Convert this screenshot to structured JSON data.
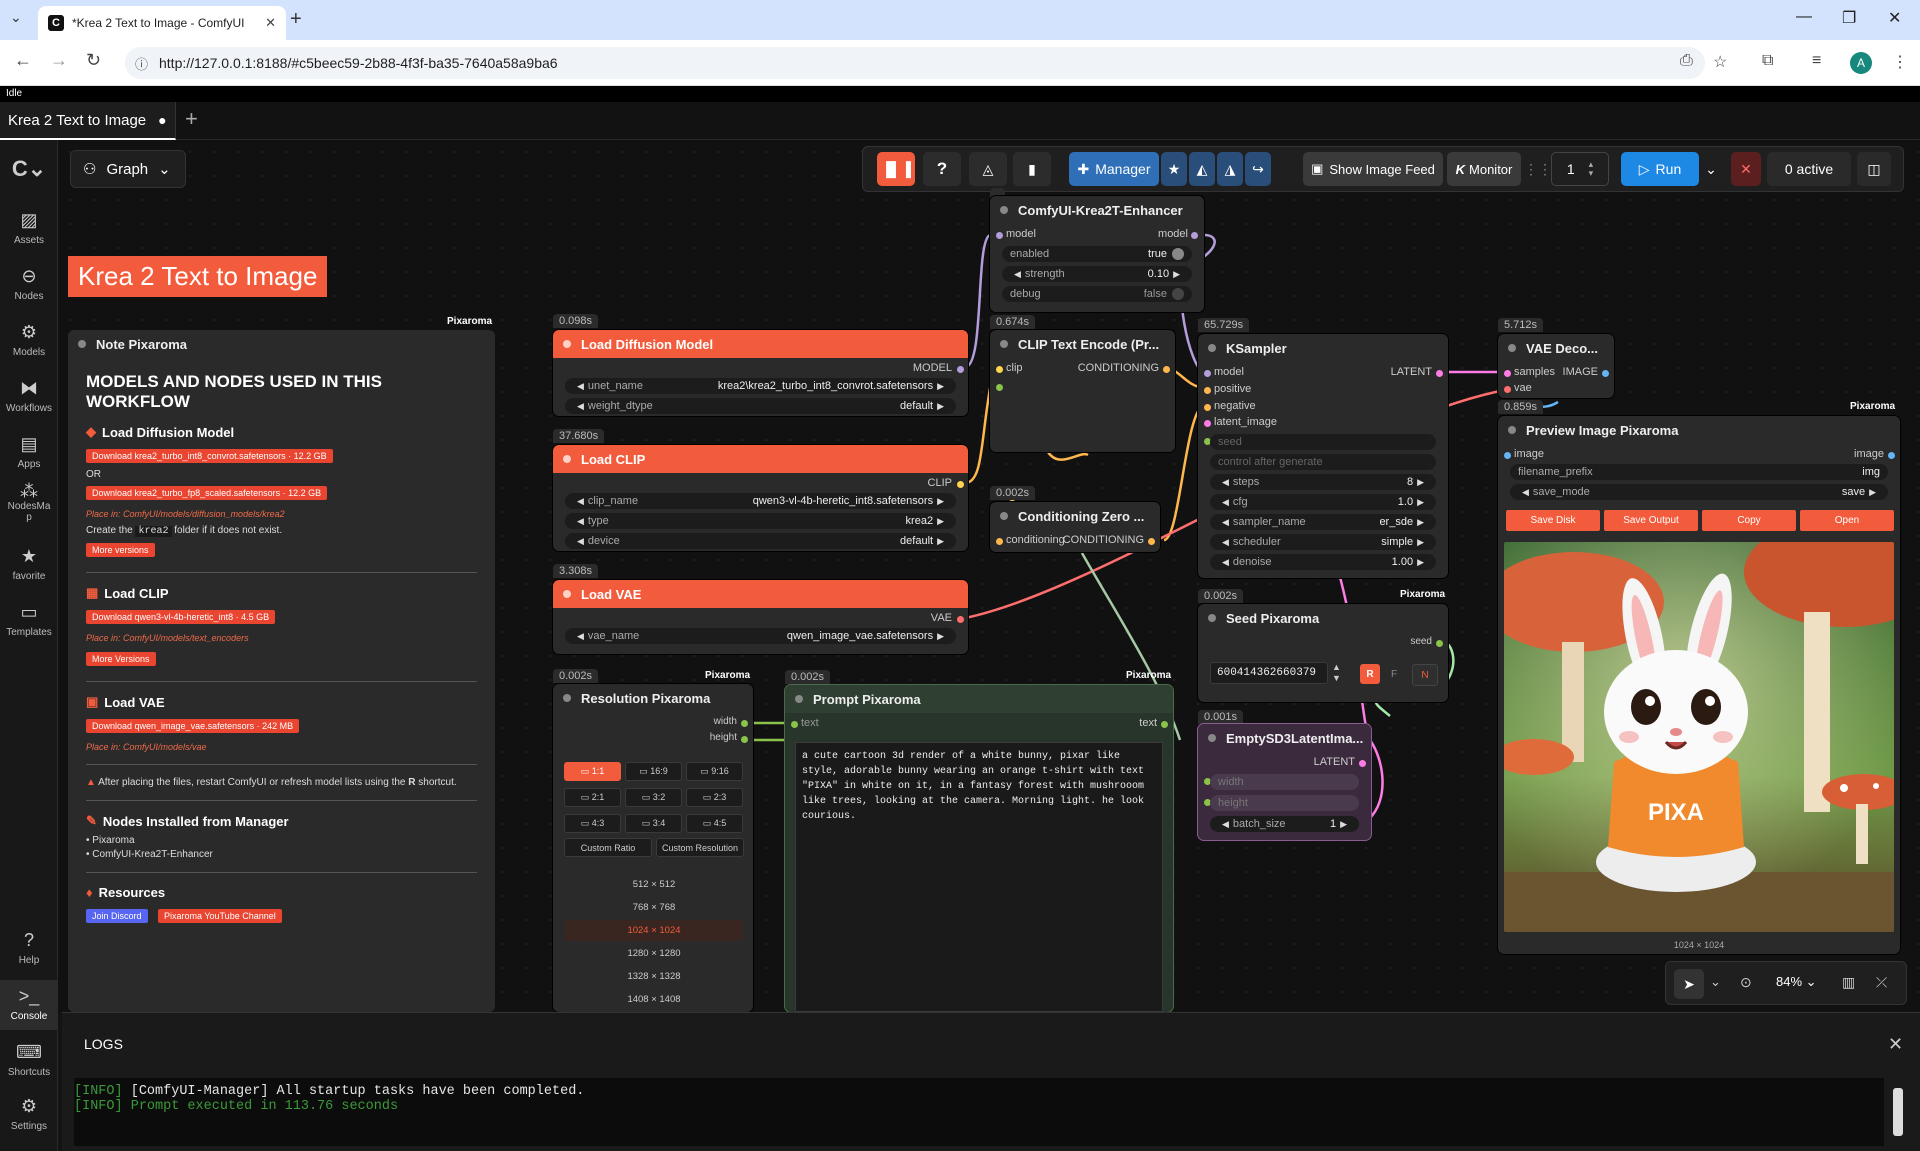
{
  "browser": {
    "tab_title": "*Krea 2 Text to Image - ComfyUI",
    "url": "http://127.0.0.1:8188/#c5beec59-2b88-4f3f-ba35-7640a58a9ba6",
    "avatar_letter": "A"
  },
  "app": {
    "status": "Idle",
    "workflow_tab": "Krea 2 Text to Image",
    "graph_label": "Graph",
    "canvas_title": "Krea 2 Text to Image"
  },
  "sidebar": {
    "items": [
      "Assets",
      "Nodes",
      "Models",
      "Workflows",
      "Apps",
      "NodesMap",
      "favorite",
      "Templates"
    ],
    "bottom": [
      "Help",
      "Console",
      "Shortcuts",
      "Settings"
    ]
  },
  "toolbar": {
    "manager": "Manager",
    "show_image_feed": "Show Image Feed",
    "monitor": "Monitor",
    "batch_count": "1",
    "run": "Run",
    "active": "0 active"
  },
  "note": {
    "tag": "Pixaroma",
    "title": "Note Pixaroma",
    "heading": "MODELS AND NODES USED IN THIS WORKFLOW",
    "s1_title": "Load Diffusion Model",
    "s1_dl1": "Download krea2_turbo_int8_convrot.safetensors · 12.2 GB",
    "s1_or": "OR",
    "s1_dl2": "Download krea2_turbo_fp8_scaled.safetensors · 12.2 GB",
    "s1_place": "Place in: ComfyUI/models/diffusion_models/krea2",
    "s1_create_a": "Create the",
    "s1_create_code": "krea2",
    "s1_create_b": "folder if it does not exist.",
    "s1_more": "More versions",
    "s2_title": "Load CLIP",
    "s2_dl": "Download qwen3-vl-4b-heretic_int8 · 4.5 GB",
    "s2_place": "Place in: ComfyUI/models/text_encoders",
    "s2_more": "More Versions",
    "s3_title": "Load VAE",
    "s3_dl": "Download qwen_image_vae.safetensors · 242 MB",
    "s3_place": "Place in: ComfyUI/models/vae",
    "warn_a": "After placing the files, restart ComfyUI or refresh model lists using the",
    "warn_key": "R",
    "warn_b": "shortcut.",
    "s4_title": "Nodes Installed from Manager",
    "s4_items": [
      "Pixaroma",
      "ComfyUI-Krea2T-Enhancer"
    ],
    "s5_title": "Resources",
    "discord": "Join Discord",
    "youtube": "Pixaroma YouTube Channel"
  },
  "nodes": {
    "enhancer": {
      "title": "ComfyUI-Krea2T-Enhancer",
      "in": "model",
      "out": "model",
      "w": [
        [
          "enabled",
          "true"
        ],
        [
          "strength",
          "0.10"
        ],
        [
          "debug",
          "false"
        ]
      ]
    },
    "load_diffusion": {
      "time": "0.098s",
      "title": "Load Diffusion Model",
      "out": "MODEL",
      "w": [
        [
          "unet_name",
          "krea2\\krea2_turbo_int8_convrot.safetensors"
        ],
        [
          "weight_dtype",
          "default"
        ]
      ]
    },
    "load_clip": {
      "time": "37.680s",
      "title": "Load CLIP",
      "out": "CLIP",
      "w": [
        [
          "clip_name",
          "qwen3-vl-4b-heretic_int8.safetensors"
        ],
        [
          "type",
          "krea2"
        ],
        [
          "device",
          "default"
        ]
      ]
    },
    "load_vae": {
      "time": "3.308s",
      "title": "Load VAE",
      "out": "VAE",
      "w": [
        [
          "vae_name",
          "qwen_image_vae.safetensors"
        ]
      ]
    },
    "clip_text": {
      "time": "0.674s",
      "title": "CLIP Text Encode (Pr...",
      "in": "clip",
      "out": "CONDITIONING"
    },
    "cond_zero": {
      "time": "0.002s",
      "title": "Conditioning Zero ...",
      "in": "conditioning",
      "out": "CONDITIONING"
    },
    "ksampler": {
      "time": "65.729s",
      "title": "KSampler",
      "out": "LATENT",
      "in": [
        "model",
        "positive",
        "negative",
        "latent_image",
        "seed"
      ],
      "control": "control after generate",
      "w": [
        [
          "steps",
          "8"
        ],
        [
          "cfg",
          "1.0"
        ],
        [
          "sampler_name",
          "er_sde"
        ],
        [
          "scheduler",
          "simple"
        ],
        [
          "denoise",
          "1.00"
        ]
      ]
    },
    "vae_decode": {
      "time": "5.712s",
      "title": "VAE Deco...",
      "in": [
        "samples",
        "vae"
      ],
      "out": "IMAGE"
    },
    "preview": {
      "time": "0.859s",
      "tag": "Pixaroma",
      "title": "Preview Image Pixaroma",
      "in": "image",
      "out": "image",
      "w": [
        [
          "filename_prefix",
          "img"
        ],
        [
          "save_mode",
          "save"
        ]
      ],
      "buttons": [
        "Save Disk",
        "Save Output",
        "Copy",
        "Open"
      ],
      "caption": "1024 × 1024",
      "shirt_text": "PIXA"
    },
    "seed": {
      "time": "0.002s",
      "tag": "Pixaroma",
      "title": "Seed Pixaroma",
      "out": "seed",
      "value": "600414362660379",
      "b1": "R",
      "b2": "F",
      "b3": "N"
    },
    "empty_latent": {
      "time": "0.001s",
      "title": "EmptySD3LatentIma...",
      "out": "LATENT",
      "w": [
        [
          "width",
          ""
        ],
        [
          "height",
          ""
        ],
        [
          "batch_size",
          "1"
        ]
      ]
    },
    "resolution": {
      "time": "0.002s",
      "tag": "Pixaroma",
      "title": "Resolution Pixaroma",
      "outs": [
        "width",
        "height"
      ],
      "ratios": [
        "1:1",
        "16:9",
        "9:16",
        "2:1",
        "3:2",
        "2:3",
        "4:3",
        "3:4",
        "4:5"
      ],
      "custom": [
        "Custom Ratio",
        "Custom Resolution"
      ],
      "sizes": [
        "512 × 512",
        "768 × 768",
        "1024 × 1024",
        "1280 × 1280",
        "1328 × 1328",
        "1408 × 1408"
      ]
    },
    "prompt": {
      "time": "0.002s",
      "tag": "Pixaroma",
      "title": "Prompt Pixaroma",
      "in": "text",
      "out": "text",
      "text": "a cute cartoon 3d render of a white bunny, pixar like style, adorable bunny wearing an orange t-shirt with text \"PIXA\" in white on it, in a fantasy forest with mushrooom like trees, looking at the camera. Morning light. he look courious."
    }
  },
  "canvas_controls": {
    "zoom": "84%"
  },
  "console": {
    "title": "LOGS",
    "lines": [
      {
        "tag": "[INFO]",
        "text": "[ComfyUI-Manager] All startup tasks have been completed."
      },
      {
        "tag": "[INFO]",
        "text": "Prompt executed in 113.76 seconds"
      }
    ]
  },
  "colors": {
    "accent": "#f25c3c",
    "run": "#1e88e5",
    "manager": "#2e6fb7",
    "node": "#2a2a2a",
    "canvas": "#111111"
  }
}
